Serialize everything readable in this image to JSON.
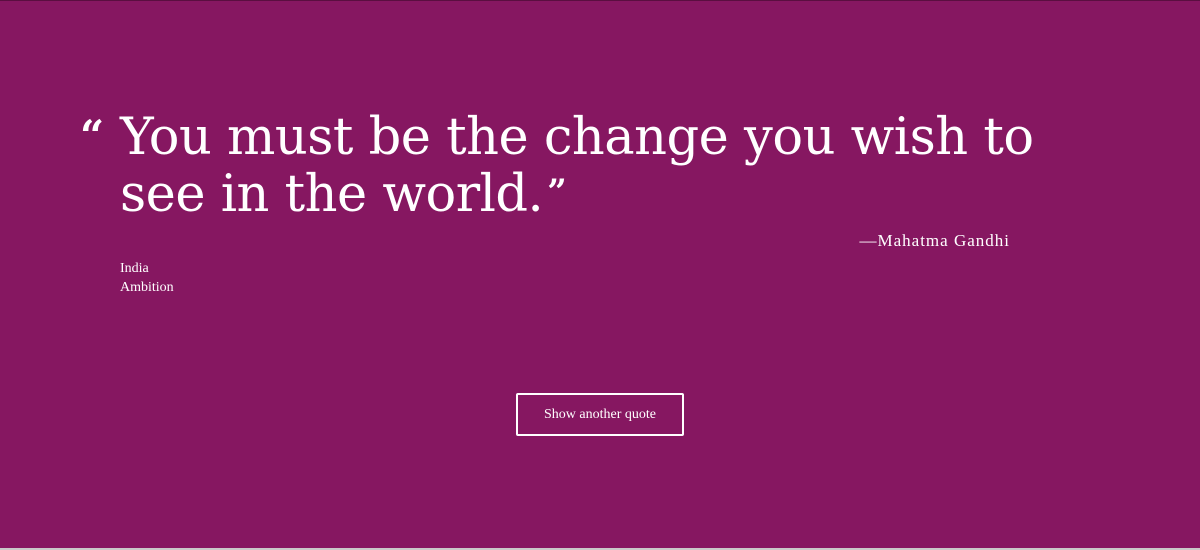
{
  "theme": {
    "background": "#861761",
    "text_color": "#ffffff"
  },
  "quote": {
    "open_mark": "“",
    "text": "You must be the change you wish to see in the world.",
    "close_mark": "”",
    "author": "—Mahatma Gandhi"
  },
  "tags": [
    {
      "label": "India"
    },
    {
      "label": "Ambition"
    }
  ],
  "actions": {
    "show_another_label": "Show another quote"
  }
}
